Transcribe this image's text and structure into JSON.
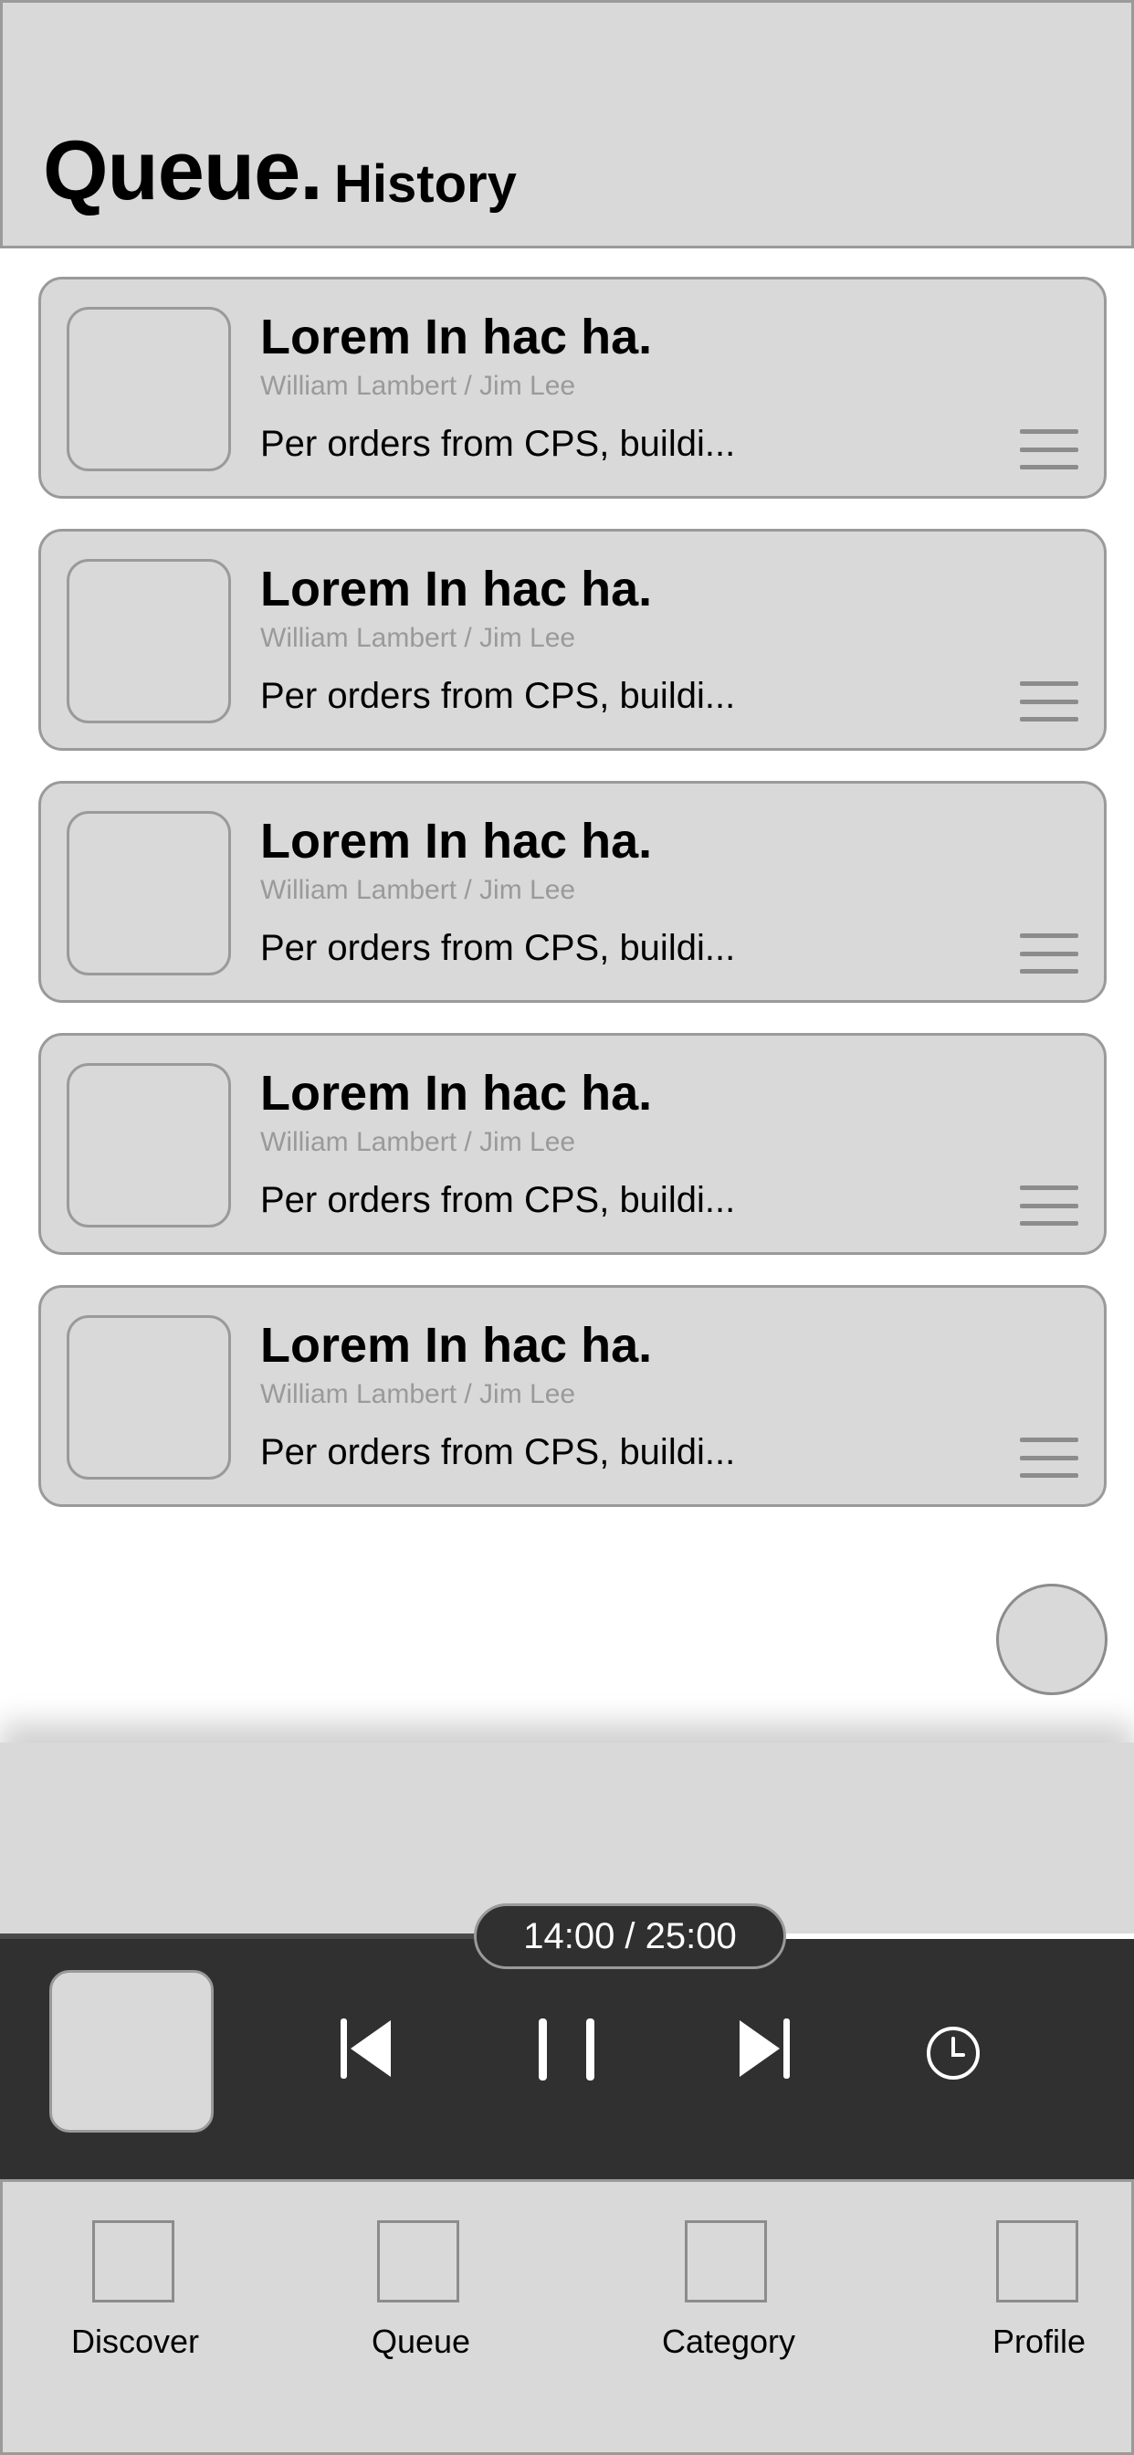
{
  "header": {
    "title": "Queue.",
    "history_tab": "History"
  },
  "queue": {
    "items": [
      {
        "title": "Lorem In hac ha.",
        "author": "William Lambert / Jim Lee",
        "description": "Per orders from CPS, buildi..."
      },
      {
        "title": "Lorem In hac ha.",
        "author": "William Lambert / Jim Lee",
        "description": "Per orders from CPS, buildi..."
      },
      {
        "title": "Lorem In hac ha.",
        "author": "William Lambert / Jim Lee",
        "description": "Per orders from CPS, buildi..."
      },
      {
        "title": "Lorem In hac ha.",
        "author": "William Lambert / Jim Lee",
        "description": "Per orders from CPS, buildi..."
      },
      {
        "title": "Lorem In hac ha.",
        "author": "William Lambert / Jim Lee",
        "description": "Per orders from CPS, buildi..."
      }
    ]
  },
  "player": {
    "time": "14:00 / 25:00",
    "progress": 0.56,
    "controls": [
      "skip-previous-icon",
      "pause-icon",
      "skip-next-icon",
      "clock-icon"
    ]
  },
  "nav": {
    "items": [
      {
        "label": "Discover",
        "icon": "discover-icon"
      },
      {
        "label": "Queue",
        "icon": "queue-icon"
      },
      {
        "label": "Category",
        "icon": "category-icon"
      },
      {
        "label": "Profile",
        "icon": "profile-icon"
      }
    ]
  },
  "colors": {
    "surface": "#d9d9d9",
    "border": "#9a9a9a",
    "player_bar": "#303030",
    "muted_text": "#9a9a9a"
  }
}
